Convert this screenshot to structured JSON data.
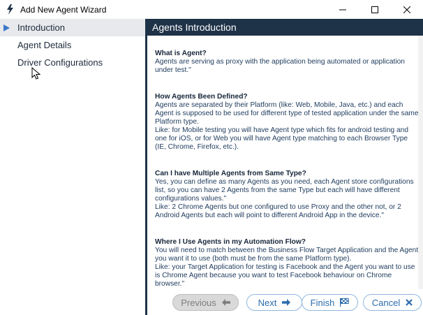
{
  "window": {
    "title": "Add New Agent Wizard",
    "icons": {
      "app": "lightning-bolt-icon",
      "minimize": "minimize-icon",
      "maximize": "maximize-icon",
      "close": "close-icon"
    }
  },
  "sidebar": {
    "items": [
      {
        "label": "Introduction",
        "active": true
      },
      {
        "label": "Agent Details",
        "active": false
      },
      {
        "label": "Driver Configurations",
        "active": false
      }
    ]
  },
  "main": {
    "header": "Agents Introduction",
    "sections": [
      {
        "title": "What is Agent?",
        "body": "Agents are serving as proxy with the application being automated or application under test.\""
      },
      {
        "title": "How Agents Been Defined?",
        "body": "Agents are separated by their Platform (like: Web, Mobile, Java, etc.) and each Agent is supposed to be used for different type of tested application under the same Platform type.\nLike: for Mobile testing you will have Agent type which fits for android testing and one for iOS, or for Web you will have Agent type matching to each Browser Type (IE, Chrome, Firefox, etc.)."
      },
      {
        "title": "Can I have Multiple Agents from Same Type?",
        "body": "Yes, you can define as many Agents as you need, each Agent store configurations list, so you can have 2 Agents from the same Type but each will have different configurations values.\"\nLike: 2 Chrome Agents but one configured to use Proxy and the other not, or 2 Android Agents but each will point to different Android App in the device.\""
      },
      {
        "title": "Where I Use Agents in my Automation Flow?",
        "body": "You will need to match between the Business Flow Target Application and the Agent you want it to use (both must be from the same Platform type).\nLike: your Target Application for testing is Facebook and the Agent you want to use is Chrome Agent because you want to test Facebook behaviour on Chrome browser.\""
      }
    ]
  },
  "footer": {
    "previous": {
      "label": "Previous",
      "icon": "arrow-left-icon",
      "enabled": false
    },
    "next": {
      "label": "Next",
      "icon": "arrow-right-icon",
      "enabled": true
    },
    "finish": {
      "label": "Finish",
      "icon": "checkered-flag-icon",
      "enabled": true
    },
    "cancel": {
      "label": "Cancel",
      "icon": "close-icon",
      "enabled": true
    }
  },
  "colors": {
    "header_bg": "#1e3248",
    "accent": "#2c6cad",
    "nav_active_bg": "#e7e9ec",
    "body_text": "#1d3a5c"
  }
}
